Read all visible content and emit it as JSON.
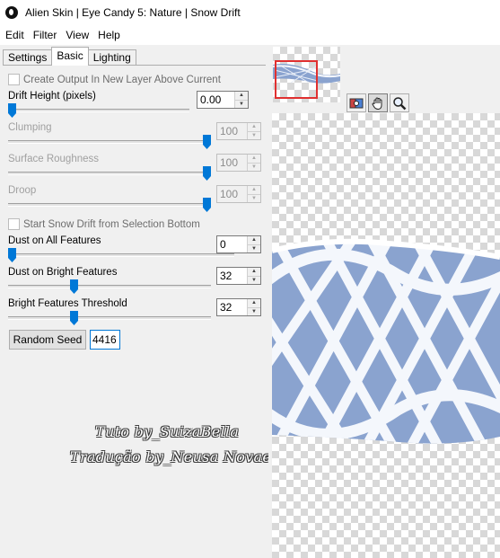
{
  "window": {
    "title": "Alien Skin | Eye Candy 5: Nature | Snow Drift"
  },
  "menu": [
    "Edit",
    "Filter",
    "View",
    "Help"
  ],
  "tabs": [
    "Settings",
    "Basic",
    "Lighting"
  ],
  "basic": {
    "create_output_label": "Create Output In New Layer Above Current",
    "drift_height": {
      "label": "Drift Height (pixels)",
      "value": "0.00",
      "level": 0
    },
    "clumping": {
      "label": "Clumping",
      "value": "100",
      "level": 1.0
    },
    "surface_roughness": {
      "label": "Surface Roughness",
      "value": "100",
      "level": 1.0
    },
    "droop": {
      "label": "Droop",
      "value": "100",
      "level": 1.0
    },
    "start_from_selection_label": "Start Snow Drift from Selection Bottom",
    "dust_all": {
      "label": "Dust on All Features",
      "value": "0",
      "level": 0
    },
    "dust_bright": {
      "label": "Dust on Bright Features",
      "value": "32",
      "level": 0.32
    },
    "bright_threshold": {
      "label": "Bright Features Threshold",
      "value": "32",
      "level": 0.32
    },
    "random_seed_label": "Random Seed",
    "random_seed_value": "4416"
  },
  "watermark": {
    "line1": "Tuto by_SuizaBella",
    "line2": "Tradução by_Neusa Novaes"
  },
  "icons": {
    "app": "alien-skin-icon",
    "tools": [
      "compare-icon",
      "hand-icon",
      "zoom-icon"
    ]
  },
  "colors": {
    "accent": "#0078d7",
    "snow_blue": "#8aa3cf",
    "snow_white": "#f4f7fc"
  }
}
